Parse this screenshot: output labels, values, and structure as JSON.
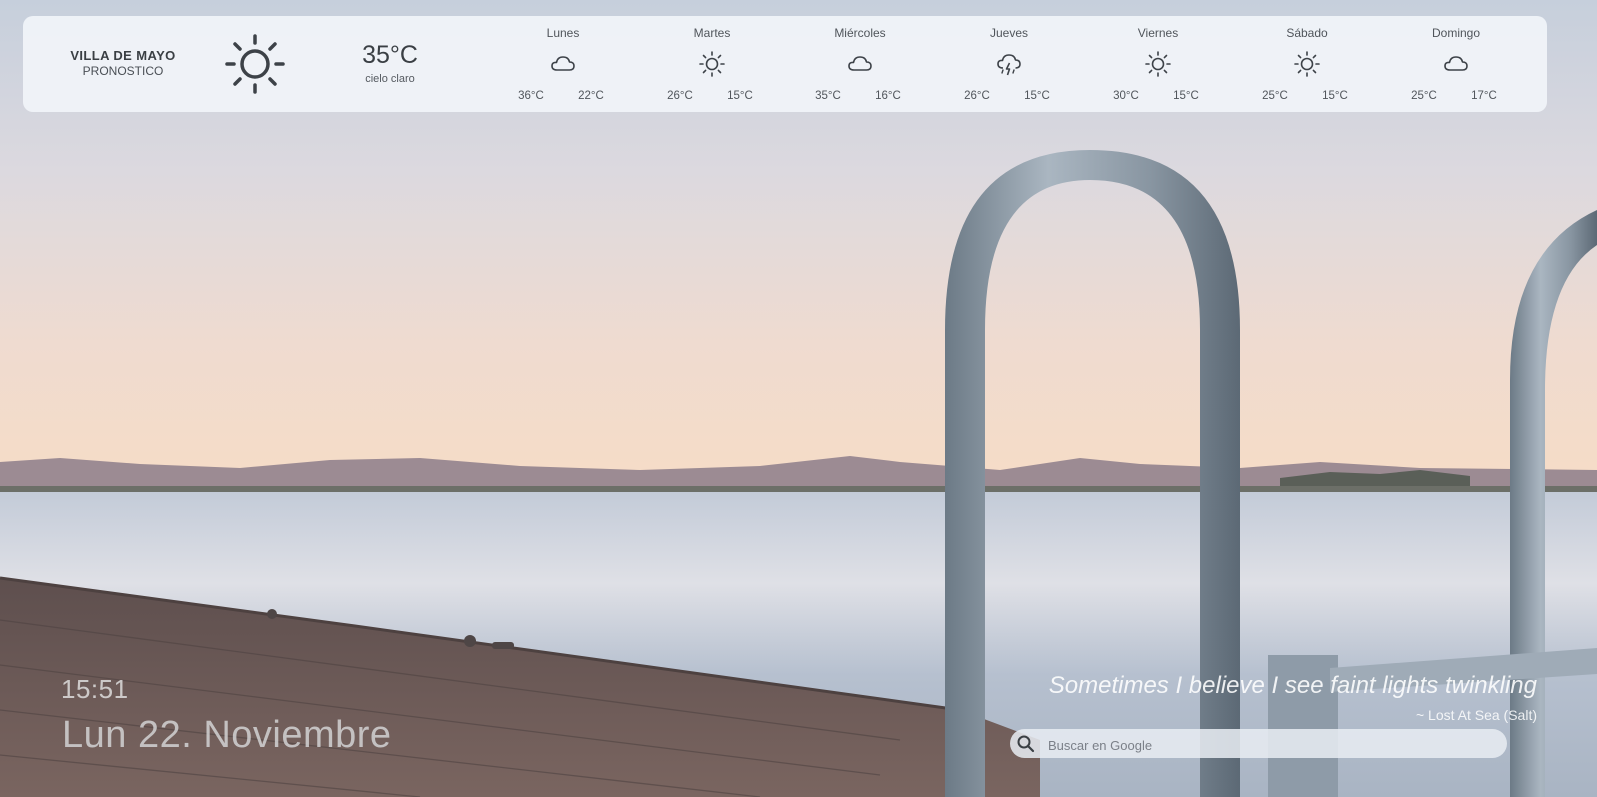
{
  "weather": {
    "location": "VILLA DE MAYO",
    "subtitle": "PRONOSTICO",
    "current": {
      "temp": "35°C",
      "description": "cielo claro",
      "icon": "sun-icon"
    },
    "days": [
      {
        "name": "Lunes",
        "icon": "cloud-icon",
        "high": "36°C",
        "low": "22°C"
      },
      {
        "name": "Martes",
        "icon": "sun-icon",
        "high": "26°C",
        "low": "15°C"
      },
      {
        "name": "Miércoles",
        "icon": "cloud-icon",
        "high": "35°C",
        "low": "16°C"
      },
      {
        "name": "Jueves",
        "icon": "thunderstorm-icon",
        "high": "26°C",
        "low": "15°C"
      },
      {
        "name": "Viernes",
        "icon": "sun-icon",
        "high": "30°C",
        "low": "15°C"
      },
      {
        "name": "Sábado",
        "icon": "sun-icon",
        "high": "25°C",
        "low": "15°C"
      },
      {
        "name": "Domingo",
        "icon": "cloud-icon",
        "high": "25°C",
        "low": "17°C"
      }
    ]
  },
  "clock": {
    "time": "15:51",
    "date": "Lun 22. Noviembre"
  },
  "quote": {
    "text": "Sometimes I believe I see faint lights twinkling",
    "source": "~ Lost At Sea (Salt)"
  },
  "search": {
    "placeholder": "Buscar en Google"
  },
  "colors": {
    "panel": "#f1f4f9",
    "text": "#3d4248",
    "sky_top": "#c9d2df",
    "sky_horizon": "#f4dac6",
    "water": "#b9c4d3",
    "dock": "#6e5a55"
  }
}
